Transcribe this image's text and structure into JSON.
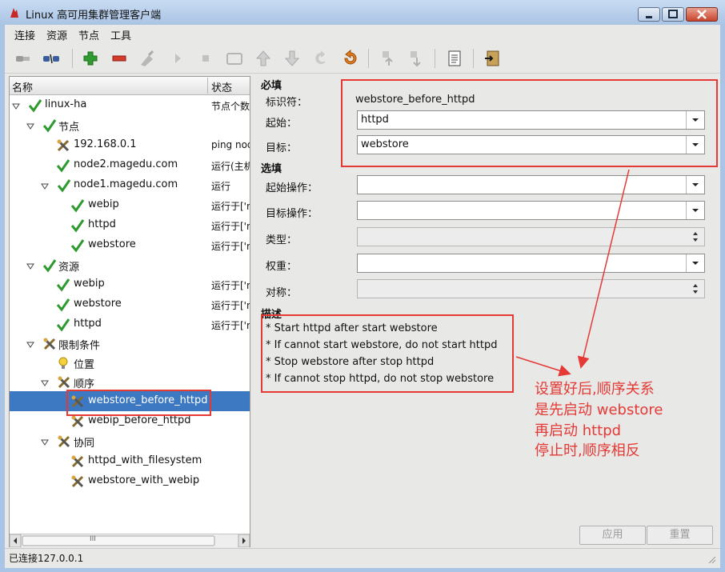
{
  "window": {
    "title": "Linux 高可用集群管理客户端"
  },
  "menu": [
    "连接",
    "资源",
    "节点",
    "工具"
  ],
  "toolbar": {
    "icons": [
      "connect-icon",
      "disconnect-icon",
      "add-icon",
      "remove-icon",
      "cleanup-icon",
      "start-icon",
      "stop-icon",
      "standby-icon",
      "up-icon",
      "down-icon",
      "migrate-icon",
      "undo-icon",
      "move-up-icon",
      "move-down-icon",
      "report-icon",
      "exit-icon"
    ]
  },
  "tree": {
    "col_name": "名称",
    "col_status": "状态",
    "rows": [
      {
        "label": "linux-ha",
        "status": "节点个数"
      },
      {
        "label": "节点",
        "status": ""
      },
      {
        "label": "192.168.0.1",
        "status": "ping node"
      },
      {
        "label": "node2.magedu.com",
        "status": "运行(主机)"
      },
      {
        "label": "node1.magedu.com",
        "status": "运行"
      },
      {
        "label": "webip",
        "status": "运行于['n"
      },
      {
        "label": "httpd",
        "status": "运行于['n"
      },
      {
        "label": "webstore",
        "status": "运行于['n"
      },
      {
        "label": "资源",
        "status": ""
      },
      {
        "label": "webip",
        "status": "运行于['n"
      },
      {
        "label": "webstore",
        "status": "运行于['n"
      },
      {
        "label": "httpd",
        "status": "运行于['n"
      },
      {
        "label": "限制条件",
        "status": ""
      },
      {
        "label": "位置",
        "status": ""
      },
      {
        "label": "顺序",
        "status": ""
      },
      {
        "label": "webstore_before_httpd",
        "status": ""
      },
      {
        "label": "webip_before_httpd",
        "status": ""
      },
      {
        "label": "协同",
        "status": ""
      },
      {
        "label": "httpd_with_filesystem",
        "status": ""
      },
      {
        "label": "webstore_with_webip",
        "status": ""
      }
    ],
    "scroll_thumb": "III"
  },
  "form": {
    "required_title": "必填",
    "id_label": "标识符：",
    "id_value": "webstore_before_httpd",
    "from_label": "起始：",
    "from_value": "httpd",
    "to_label": "目标：",
    "to_value": "webstore",
    "optional_title": "选填",
    "from_action_label": "起始操作：",
    "to_action_label": "目标操作：",
    "type_label": "类型：",
    "weight_label": "权重：",
    "symmetric_label": "对称：",
    "desc_title": "描述",
    "desc_lines": [
      "* Start httpd after start webstore",
      "* If cannot start webstore, do not start httpd",
      "* Stop webstore after stop httpd",
      "* If cannot stop httpd, do not stop webstore"
    ],
    "apply_label": "应用",
    "reset_label": "重置"
  },
  "annotation": {
    "lines": [
      "设置好后,顺序关系",
      "是先启动 webstore",
      "再启动 httpd",
      "停止时,顺序相反"
    ],
    "color": "#e53935"
  },
  "statusbar": {
    "text": "已连接127.0.0.1"
  },
  "colors": {
    "selection": "#3c79c2",
    "check": "#2e9a2e"
  }
}
